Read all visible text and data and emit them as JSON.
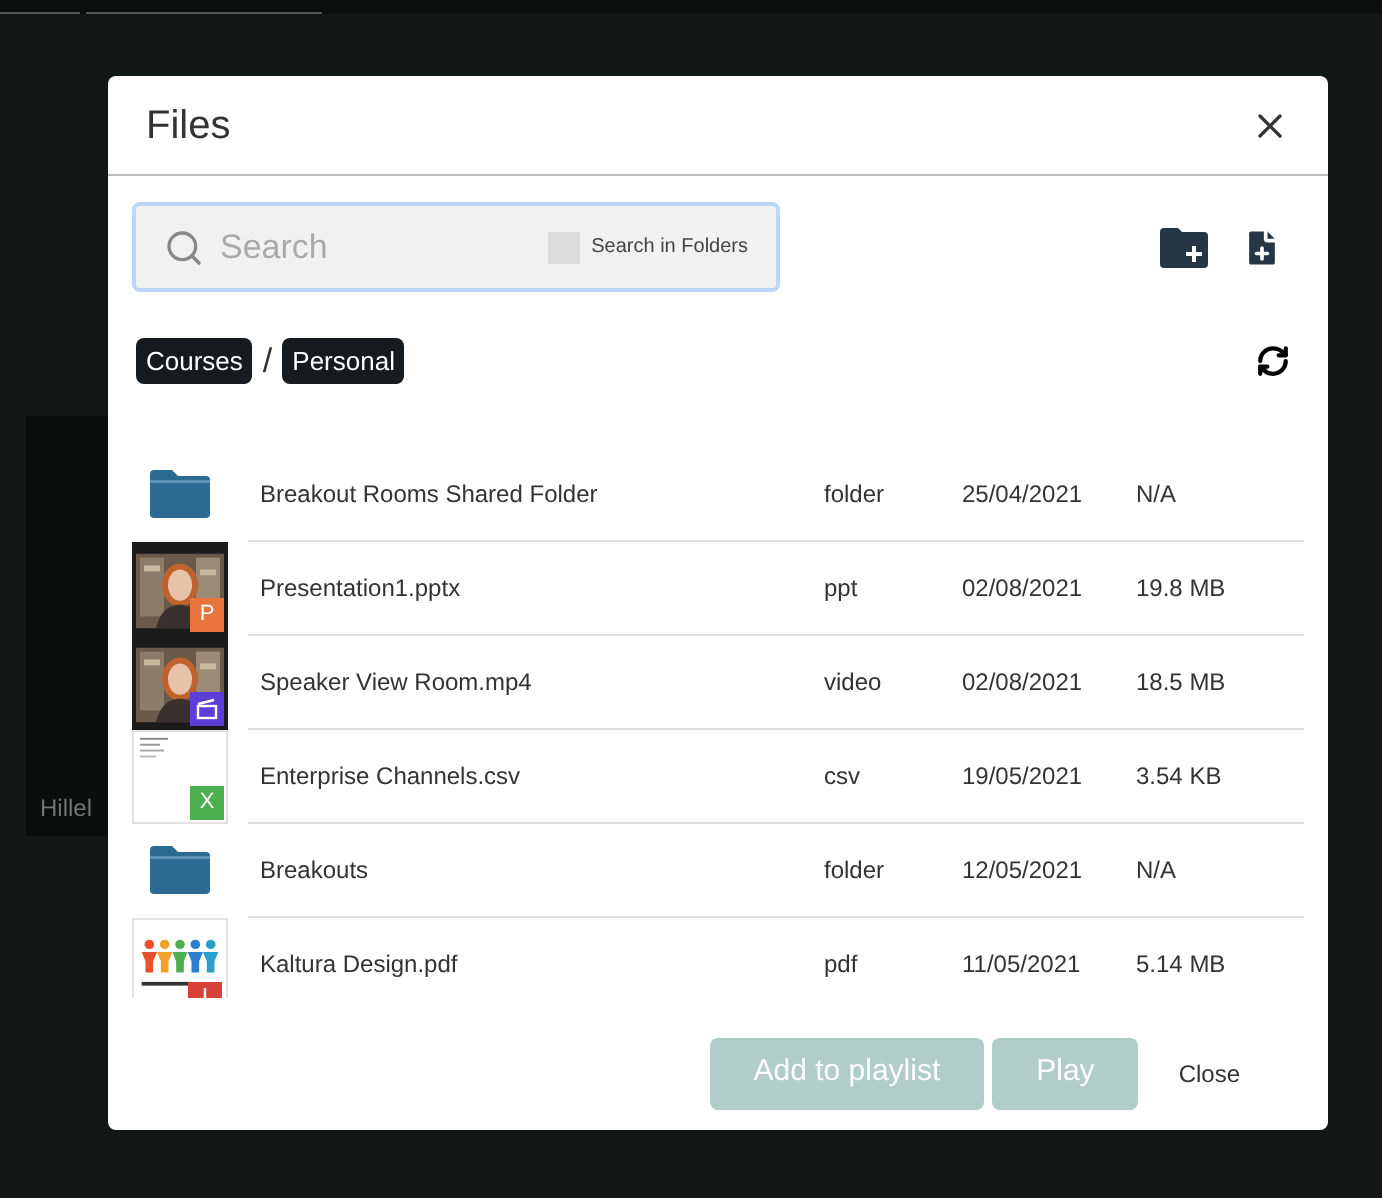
{
  "background": {
    "tile_label": "Hillel"
  },
  "dialog": {
    "title": "Files",
    "search": {
      "placeholder": "Search",
      "in_folders": {
        "label": "Search in Folders",
        "checked": false
      }
    },
    "breadcrumbs": [
      "Courses",
      "Personal"
    ],
    "breadcrumb_separator": "/",
    "files": [
      {
        "kind": "folder",
        "name": "Breakout Rooms Shared Folder",
        "type": "folder",
        "date": "25/04/2021",
        "size": "N/A"
      },
      {
        "badge": {
          "kind": "letter",
          "text": "P",
          "color": "#e8733d"
        },
        "name": "Presentation1.pptx",
        "type": "ppt",
        "date": "02/08/2021",
        "size": "19.8 MB"
      },
      {
        "badge": {
          "kind": "video",
          "color": "#5b3fd6"
        },
        "name": "Speaker View Room.mp4",
        "type": "video",
        "date": "02/08/2021",
        "size": "18.5 MB"
      },
      {
        "kind": "document",
        "badge": {
          "kind": "letter",
          "text": "X",
          "color": "#4caf50"
        },
        "name": "Enterprise Channels.csv",
        "type": "csv",
        "date": "19/05/2021",
        "size": "3.54 KB"
      },
      {
        "kind": "folder",
        "name": "Breakouts",
        "type": "folder",
        "date": "12/05/2021",
        "size": "N/A"
      },
      {
        "kind": "figures",
        "badge": {
          "kind": "pdf",
          "color": "#d9403a"
        },
        "name": "Kaltura Design.pdf",
        "type": "pdf",
        "date": "11/05/2021",
        "size": "5.14 MB"
      }
    ],
    "buttons": [
      {
        "label": "Add to playlist",
        "kind": "primary",
        "disabled": true
      },
      {
        "label": "Play",
        "kind": "primary",
        "disabled": true
      },
      {
        "label": "Close",
        "kind": "link",
        "disabled": false
      }
    ]
  }
}
